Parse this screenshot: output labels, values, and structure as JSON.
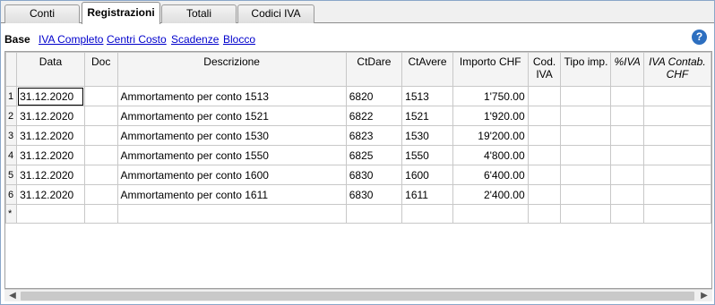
{
  "tabs": [
    {
      "label": "Conti"
    },
    {
      "label": "Registrazioni"
    },
    {
      "label": "Totali"
    },
    {
      "label": "Codici IVA"
    }
  ],
  "views": {
    "base": "Base",
    "links": [
      "IVA Completo",
      "Centri Costo",
      "Scadenze",
      "Blocco"
    ]
  },
  "help_icon": "?",
  "columns": [
    "Data",
    "Doc",
    "Descrizione",
    "CtDare",
    "CtAvere",
    "Importo CHF",
    "Cod. IVA",
    "Tipo imp.",
    "%IVA",
    "IVA Contab. CHF"
  ],
  "rows": [
    {
      "n": "1",
      "data": "31.12.2020",
      "doc": "",
      "descrizione": "Ammortamento per conto 1513",
      "ctdare": "6820",
      "ctavere": "1513",
      "importo": "1'750.00"
    },
    {
      "n": "2",
      "data": "31.12.2020",
      "doc": "",
      "descrizione": "Ammortamento per conto 1521",
      "ctdare": "6822",
      "ctavere": "1521",
      "importo": "1'920.00"
    },
    {
      "n": "3",
      "data": "31.12.2020",
      "doc": "",
      "descrizione": "Ammortamento per conto 1530",
      "ctdare": "6823",
      "ctavere": "1530",
      "importo": "19'200.00"
    },
    {
      "n": "4",
      "data": "31.12.2020",
      "doc": "",
      "descrizione": "Ammortamento per conto 1550",
      "ctdare": "6825",
      "ctavere": "1550",
      "importo": "4'800.00"
    },
    {
      "n": "5",
      "data": "31.12.2020",
      "doc": "",
      "descrizione": "Ammortamento per conto 1600",
      "ctdare": "6830",
      "ctavere": "1600",
      "importo": "6'400.00"
    },
    {
      "n": "6",
      "data": "31.12.2020",
      "doc": "",
      "descrizione": "Ammortamento per conto 1611",
      "ctdare": "6830",
      "ctavere": "1611",
      "importo": "2'400.00"
    }
  ],
  "new_row_marker": "*"
}
